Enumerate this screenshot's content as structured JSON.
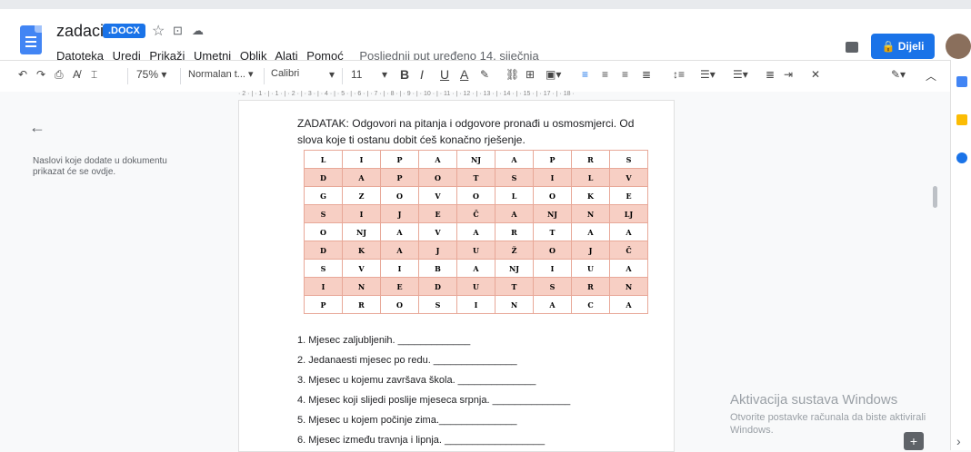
{
  "doc": {
    "title": "zadaci",
    "badge": ".DOCX"
  },
  "menu": {
    "items": [
      "Datoteka",
      "Uredi",
      "Prikaži",
      "Umetni",
      "Oblik",
      "Alati",
      "Pomoć"
    ],
    "last_edit": "Posljednji put uređeno 14. siječnja"
  },
  "share": {
    "label": "Dijeli"
  },
  "toolbar": {
    "zoom": "75%",
    "style": "Normalan t...",
    "font": "Calibri",
    "size": "11"
  },
  "ruler": {
    "text": "· 2 · | · 1 · | · 1 · | · 2 · | · 3 · | · 4 · | · 5 · | · 6 · | · 7 · | · 8 · | · 9 · | · 10 · | · 11 · | · 12 · | · 13 · | · 14 · | · 15 · | · 17 · | · 18 ·"
  },
  "outline": {
    "hint": "Naslovi koje dodate u dokumentu prikazat će se ovdje."
  },
  "content": {
    "intro": "ZADATAK: Odgovori na pitanja i odgovore pronađi u osmosmjerci. Od slova koje ti ostanu dobit ćeš konačno rješenje.",
    "grid": [
      [
        "L",
        "I",
        "P",
        "A",
        "NJ",
        "A",
        "P",
        "R",
        "S"
      ],
      [
        "D",
        "A",
        "P",
        "O",
        "T",
        "S",
        "I",
        "L",
        "V"
      ],
      [
        "G",
        "Z",
        "O",
        "V",
        "O",
        "L",
        "O",
        "K",
        "E"
      ],
      [
        "S",
        "I",
        "J",
        "E",
        "Č",
        "A",
        "NJ",
        "N",
        "LJ"
      ],
      [
        "O",
        "NJ",
        "A",
        "V",
        "A",
        "R",
        "T",
        "A",
        "A"
      ],
      [
        "D",
        "K",
        "A",
        "J",
        "U",
        "Ž",
        "O",
        "J",
        "Č"
      ],
      [
        "S",
        "V",
        "I",
        "B",
        "A",
        "NJ",
        "I",
        "U",
        "A"
      ],
      [
        "I",
        "N",
        "E",
        "D",
        "U",
        "T",
        "S",
        "R",
        "N"
      ],
      [
        "P",
        "R",
        "O",
        "S",
        "I",
        "N",
        "A",
        "C",
        "A"
      ]
    ],
    "questions": [
      "1. Mjesec zaljubljenih. _____________",
      "2. Jedanaesti mjesec po redu. _______________",
      "3. Mjesec u kojemu završava škola. ______________",
      "4. Mjesec koji slijedi poslije mjeseca srpnja. ______________",
      "5. Mjesec u kojem počinje zima.______________",
      "6. Mjesec između travnja i lipnja. __________________"
    ]
  },
  "watermark": {
    "line1": "Aktivacija sustava Windows",
    "line2": "Otvorite postavke računala da biste aktivirali Windows."
  },
  "colors": {
    "accent": "#1a73e8",
    "grid_alt": "#f7cfc4",
    "grid_border": "#e8a898"
  }
}
